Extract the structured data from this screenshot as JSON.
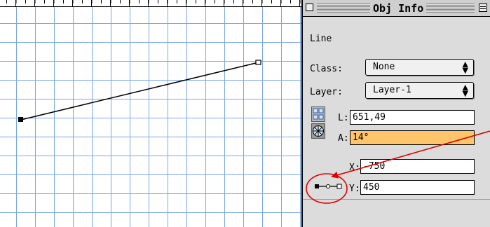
{
  "palette": {
    "title": "Obj Info",
    "object_type": "Line",
    "class": {
      "label": "Class:",
      "value": "None"
    },
    "layer": {
      "label": "Layer:",
      "value": "Layer-1"
    },
    "length": {
      "label": "L:",
      "value": "651,49"
    },
    "angle": {
      "label": "A:",
      "value": "14°"
    },
    "x": {
      "label": "X:",
      "value": "-750"
    },
    "y": {
      "label": "Y:",
      "value": "450"
    }
  },
  "icons": {
    "close": "close-box",
    "zoom": "zoom-box",
    "popup_arrows": "up-down-arrows-icon",
    "rect_mode": "rectangular-coordinates-icon",
    "polar_mode": "polar-coordinates-icon",
    "endpoint": "line-endpoint-icon"
  },
  "colors": {
    "grid": "#7aa7e6",
    "highlight_field": "#ffc56a",
    "annotation": "#e00000"
  }
}
